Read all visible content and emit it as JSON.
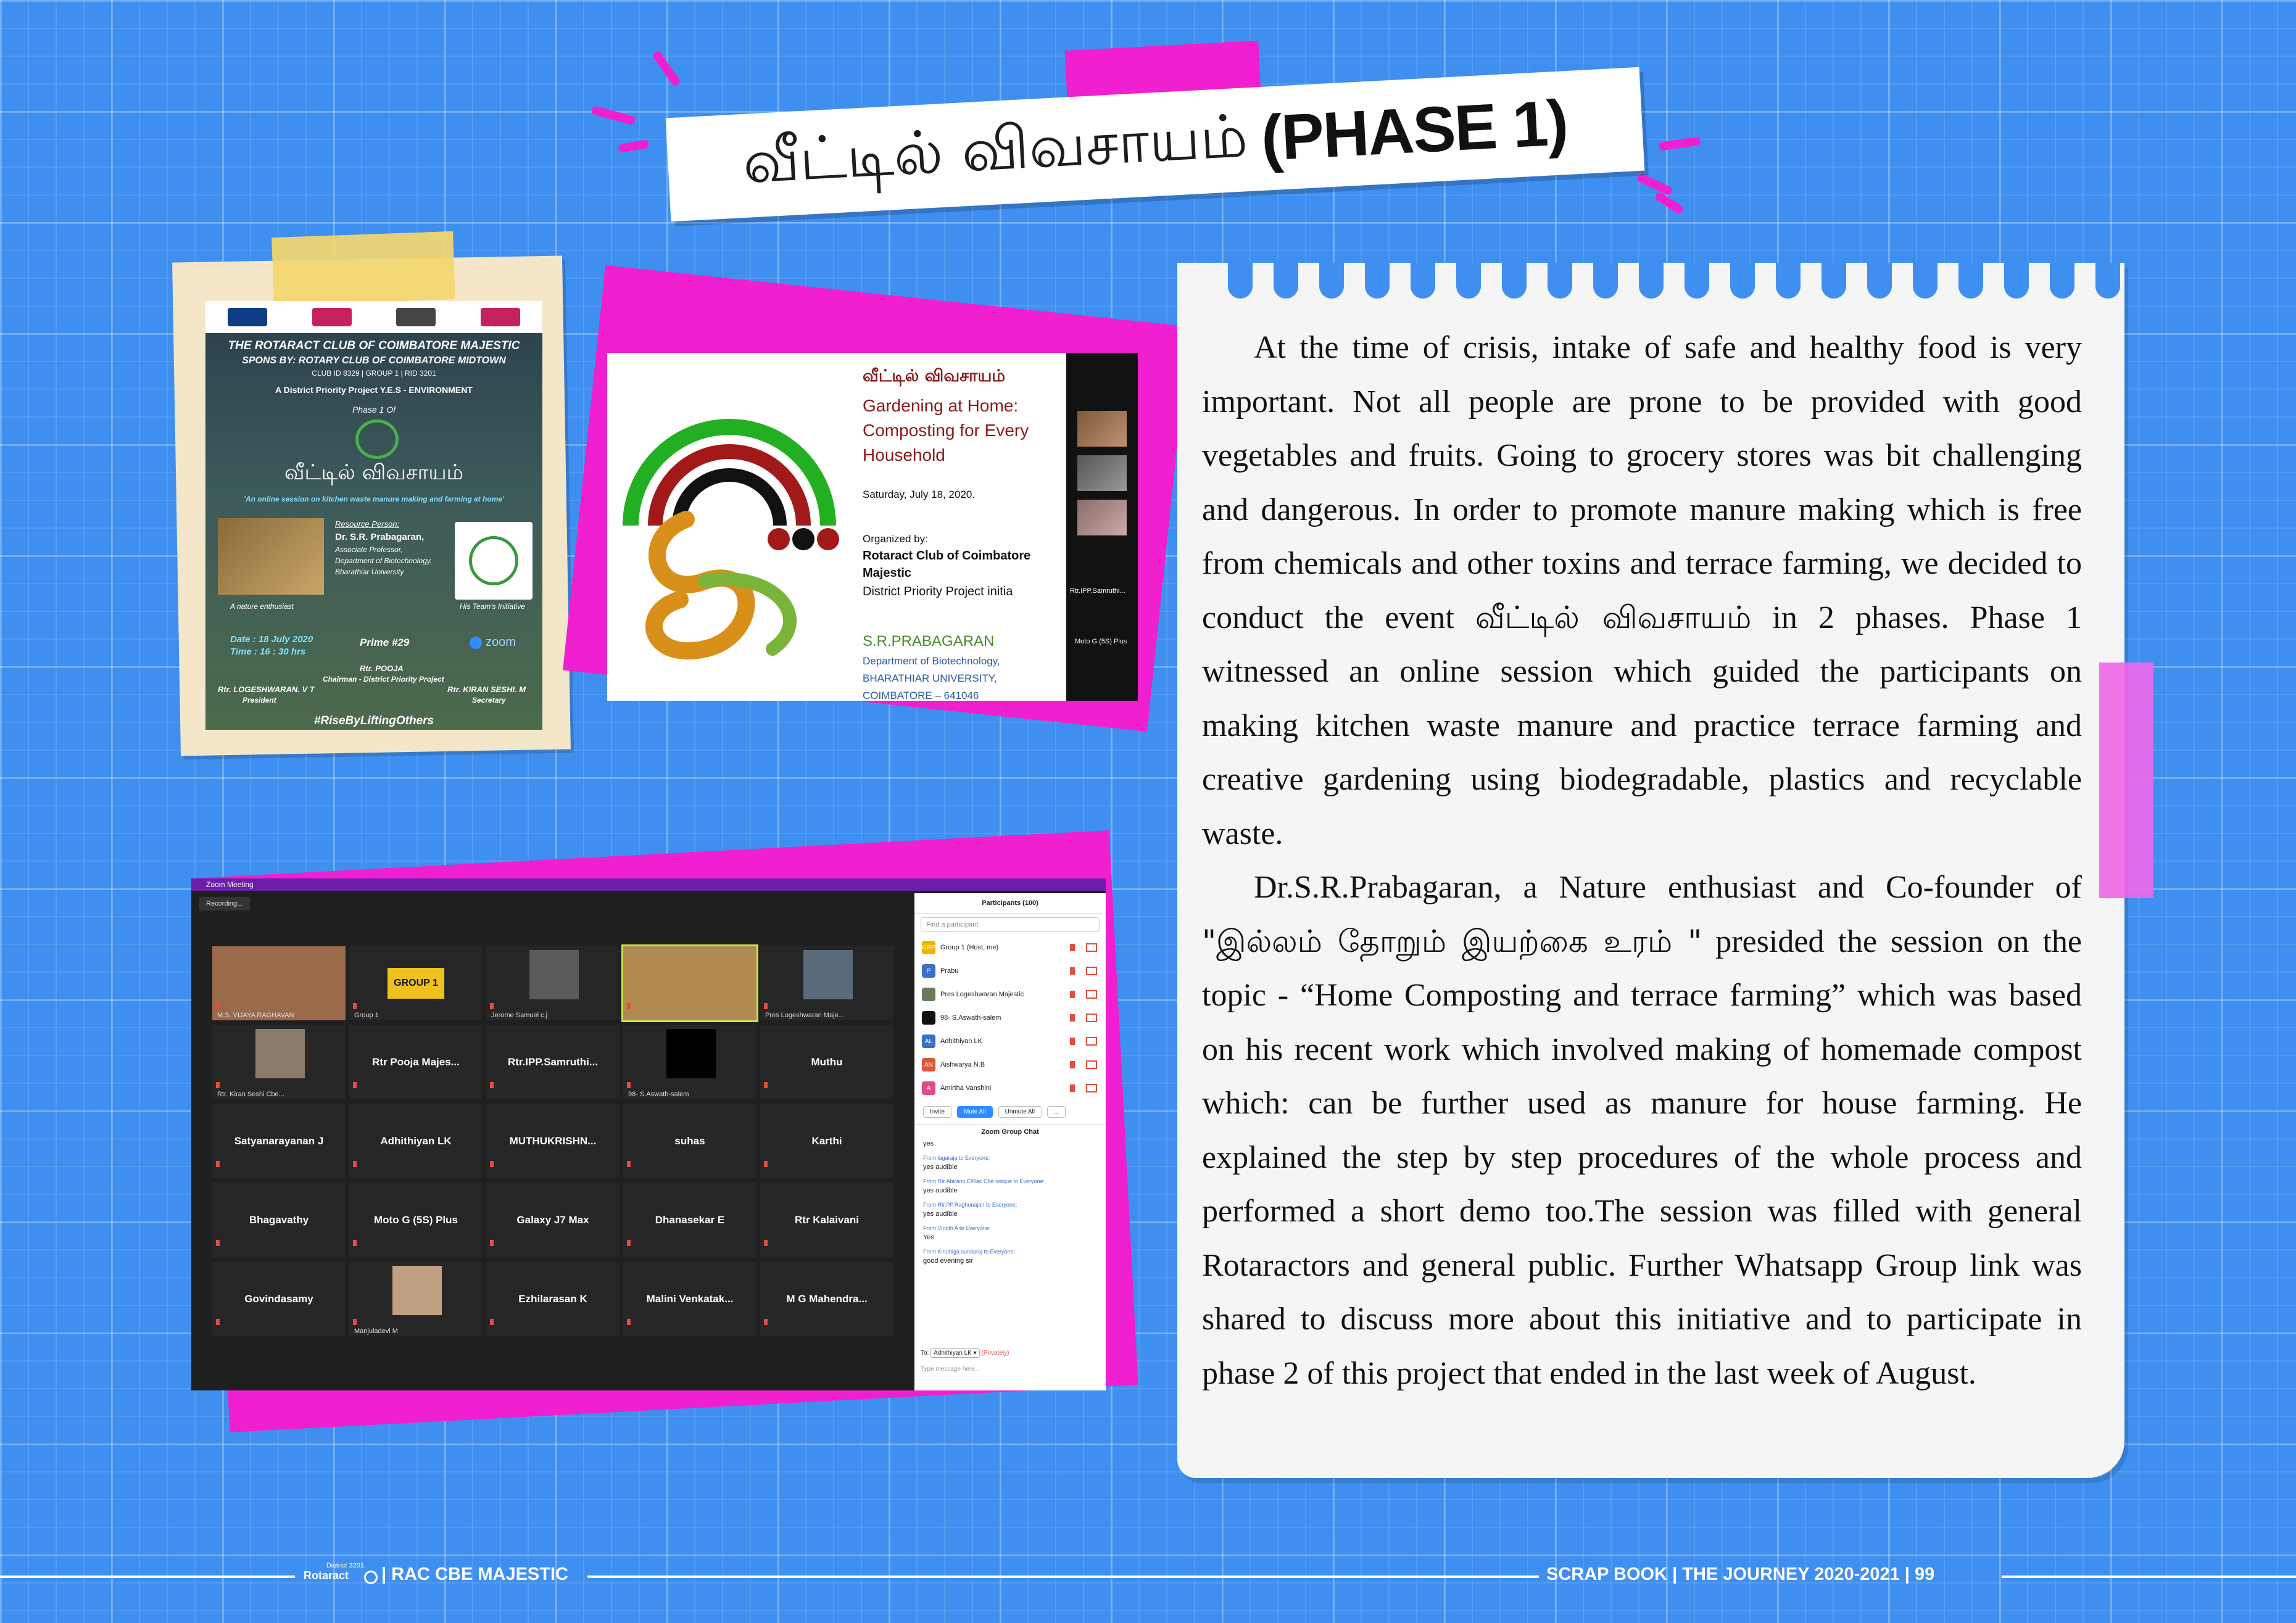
{
  "title": {
    "tamil": "வீட்டில் விவசாயம்",
    "english": "(PHASE 1)"
  },
  "poster1": {
    "club": "THE ROTARACT CLUB OF COIMBATORE MAJESTIC",
    "spons": "SPONS BY: ROTARY CLUB OF COIMBATORE MIDTOWN",
    "club_id": "CLUB ID 8329 | GROUP 1 | RID 3201",
    "project": "A District Priority Project Y.E.S - ENVIRONMENT",
    "phase": "Phase 1 Of",
    "event_ta": "வீட்டில் விவசாயம்",
    "tagline": "'An online session on kitchen waste manure making and farming at home'",
    "resource_label": "Resource Person:",
    "speaker": "Dr. S.R. Prabagaran,",
    "role1": "Associate Professor,",
    "role2": "Department of Biotechnology,",
    "role3": "Bharathiar University",
    "nature": "A nature enthusiast",
    "initiative": "His Team's Initiative",
    "date": "Date : 18 July 2020",
    "time": "Time : 16 : 30 hrs",
    "prime": "Prime #29",
    "zoom": "zoom",
    "chair_name": "Rtr. POOJA",
    "chair_role": "Chairman - District Priority Project",
    "pres_name": "Rtr. LOGESHWARAN. V T",
    "pres_role": "President",
    "sec_name": "Rtr. KIRAN SESHI. M",
    "sec_role": "Secretary",
    "hashtag": "#RiseByLiftingOthers"
  },
  "slide": {
    "title_ta": "வீட்டில் விவசாயம்",
    "line1": "Gardening at Home:",
    "line2": "Composting for Every",
    "line3": "Household",
    "date": "Saturday, July 18, 2020.",
    "org_label": "Organized by:",
    "org1": "Rotaract Club of Coimbatore",
    "org2": "Majestic",
    "org3": "District Priority Project  initia",
    "speaker": "S.R.PRABAGARAN",
    "dept": "Department  of  Biotechnology,",
    "univ": "BHARATHIAR UNIVERSITY,",
    "city": "COIMBATORE – 641046",
    "side1": "Rtr.IPP.Samruthi...",
    "side2": "Moto G (5S) Plus"
  },
  "zoom": {
    "window_title": "Zoom Meeting",
    "recording": "Recording...",
    "tiles": [
      {
        "name": "",
        "label": "M.S. VIJAYA RAGHAVAN"
      },
      {
        "name": "GROUP 1",
        "label": "Group 1"
      },
      {
        "name": "",
        "label": "Jerome Samuel c.j"
      },
      {
        "name": "",
        "label": ""
      },
      {
        "name": "",
        "label": "Pres Logeshwaran Maje..."
      },
      {
        "name": "",
        "label": "Rtr. Kiran Seshi Cbe..."
      },
      {
        "name": "Rtr Pooja Majes...",
        "label": ""
      },
      {
        "name": "Rtr.IPP.Samruthi...",
        "label": ""
      },
      {
        "name": "",
        "label": "98- S.Aswath-salem"
      },
      {
        "name": "Muthu",
        "label": ""
      },
      {
        "name": "Satyanarayanan J",
        "label": ""
      },
      {
        "name": "Adhithiyan LK",
        "label": ""
      },
      {
        "name": "MUTHUKRISHN...",
        "label": ""
      },
      {
        "name": "suhas",
        "label": ""
      },
      {
        "name": "Karthi",
        "label": ""
      },
      {
        "name": "Bhagavathy",
        "label": ""
      },
      {
        "name": "Moto G (5S) Plus",
        "label": ""
      },
      {
        "name": "Galaxy J7 Max",
        "label": ""
      },
      {
        "name": "Dhanasekar E",
        "label": ""
      },
      {
        "name": "Rtr Kalaivani",
        "label": ""
      },
      {
        "name": "Govindasamy",
        "label": ""
      },
      {
        "name": "",
        "label": "Manjuladevi M"
      },
      {
        "name": "Ezhilarasan K",
        "label": ""
      },
      {
        "name": "Malini  Venkatak...",
        "label": ""
      },
      {
        "name": "M G Mahendra...",
        "label": ""
      }
    ],
    "participants_title": "Participants (100)",
    "find": "Find a participant",
    "participants": [
      {
        "avatar": "GRP",
        "name": "Group 1 (Host, me)",
        "color": "#f0b400"
      },
      {
        "avatar": "P",
        "name": "Prabu",
        "color": "#3b70c9"
      },
      {
        "avatar": "",
        "name": "Pres Logeshwaran Majestic",
        "color": "#6a7a5a"
      },
      {
        "avatar": "",
        "name": "98- S.Aswath-salem",
        "color": "#111111"
      },
      {
        "avatar": "AL",
        "name": "Adhithiyan LK",
        "color": "#3b70c9"
      },
      {
        "avatar": "AN",
        "name": "Aishwarya N.B",
        "color": "#e0563a"
      },
      {
        "avatar": "A",
        "name": "Amirtha Vanshini",
        "color": "#e04a8a"
      }
    ],
    "btn_invite": "Invite",
    "btn_mute": "Mute All",
    "btn_unmute": "Unmute All",
    "btn_more": "...",
    "chat_title": "Zoom Group Chat",
    "chat": [
      {
        "from": "",
        "msg": "yes"
      },
      {
        "from": "From lagaraja to Everyone:",
        "msg": "yes audible"
      },
      {
        "from": "From Rtr.Abirami C/Rac Cbe unique to Everyone:",
        "msg": "yes audible"
      },
      {
        "from": "From Rtr.PP.Raghunajan to Everyone:",
        "msg": "yes audible"
      },
      {
        "from": "From Vinoth A to Everyone:",
        "msg": "Yes"
      },
      {
        "from": "From Kiruthiga sundaraj to Everyone:",
        "msg": "good evening sir"
      }
    ],
    "to_label": "To:",
    "to_value": "Adhithiyan LK ▾",
    "privately": "(Privately)",
    "type_placeholder": "Type message here..."
  },
  "notepad": {
    "p1_a": "At the time of crisis, intake of safe and healthy food is very important. Not all people are prone to be provided with good vegetables and fruits. Going to grocery stores was bit challenging and dangerous. In order to promote manure making which is free from chemicals and other toxins and terrace farming, we decided to conduct the event ",
    "p1_ta": "வீட்டில் விவசாயம்",
    "p1_b": " in 2 phases. Phase 1 witnessed an online session which guided the participants on making kitchen waste manure and practice terrace farming and creative gardening using biodegradable, plastics and recyclable waste.",
    "p2_a": "Dr.S.R.Prabagaran, a Nature enthusiast and Co-founder of ",
    "p2_ta": "\"இல்லம் தோறும் இயற்கை உரம் \"",
    "p2_b": " presided the session on the topic - “Home Composting and terrace farming” which was based on his recent work which involved making of homemade compost which: can be further used as manure for house farming. He explained the step by step procedures of the whole process and performed a short demo too.The session was filled with general Rotaractors and general public. Further Whatsapp Group link was shared to discuss more about  this initiative and to participate in phase 2 of this project that ended in the last week of August."
  },
  "footer": {
    "district": "District 3201",
    "rotaract": "Rotaract",
    "left": "| RAC CBE MAJESTIC",
    "right": "SCRAP BOOK | THE JOURNEY 2020-2021 | 99"
  }
}
